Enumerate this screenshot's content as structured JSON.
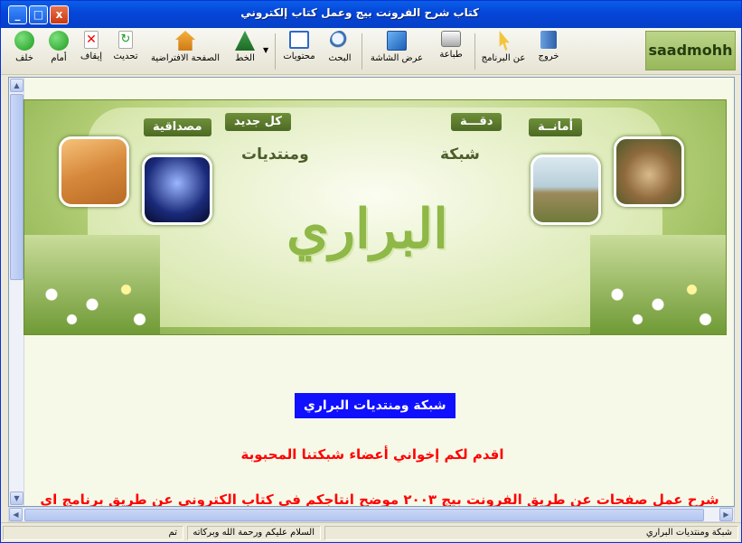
{
  "window": {
    "title": "كتاب شرح الفرونت بيج وعمل كتاب إلكتروني",
    "min": "_",
    "max": "□",
    "close": "x"
  },
  "toolbar": {
    "items": [
      {
        "label": "خلف",
        "icon": "back-icon"
      },
      {
        "label": "أمام",
        "icon": "forward-icon"
      },
      {
        "label": "إيقاف",
        "icon": "stop-icon"
      },
      {
        "label": "تحديث",
        "icon": "refresh-icon"
      },
      {
        "label": "الصفحة الافتراضية",
        "icon": "home-icon"
      },
      {
        "label": "الخط",
        "icon": "font-icon"
      },
      {
        "label": "محتويات",
        "icon": "contents-icon"
      },
      {
        "label": "البحث",
        "icon": "search-icon"
      },
      {
        "label": "عرض الشاشة",
        "icon": "fullscreen-icon"
      },
      {
        "label": "طباعة",
        "icon": "print-icon"
      },
      {
        "label": "عن البرنامج",
        "icon": "about-icon"
      },
      {
        "label": "خروج",
        "icon": "exit-icon"
      }
    ],
    "brand": "saadmohh"
  },
  "banner": {
    "tag_friendship": "مصداقية",
    "tag_new": "كل جديد",
    "tag_accuracy": "دقـــة",
    "tag_honesty": "أمانــة",
    "word_forums": "ومنتديات",
    "word_network": "شبكة",
    "calligraphy": "البراري"
  },
  "content": {
    "headline": "شبكة ومنتديات البراري",
    "greeting": "اقدم لكم إخواني أعضاء شبكتنا المحبوبة",
    "intro": "شرح عمل صفحات عن طريق الفرونت بيج ٢٠٠٣ موضح انتاجكم في كتاب الكتروني عن طريق برنامج اي"
  },
  "status": {
    "done": "تم",
    "salam": "السلام عليكم ورحمة الله وبركاته",
    "site": "شبكة ومنتديات البراري"
  },
  "colors": {
    "title_bar": "#0545D8",
    "headline_bg": "#1010FF",
    "text_red": "#FF0000",
    "content_bg": "#F7F9E8"
  }
}
